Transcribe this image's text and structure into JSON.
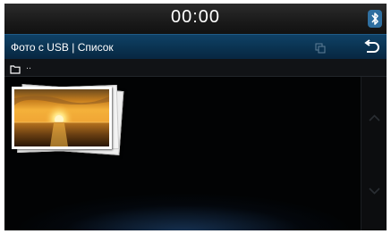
{
  "status_bar": {
    "clock": "00:00",
    "bluetooth_icon": "bluetooth-icon"
  },
  "title_bar": {
    "title": "Фото с USB | Список",
    "copy_icon": "copy-icon",
    "back_icon": "back-arrow-icon"
  },
  "path_bar": {
    "folder_icon": "folder-icon",
    "path": ".."
  },
  "photos": [
    {
      "name": "photo-thumbnail-sunset",
      "icon": "sunset-photo"
    }
  ],
  "scroll": {
    "up_icon": "chevron-up-icon",
    "down_icon": "chevron-down-icon"
  },
  "colors": {
    "title_bar": "#0a3250",
    "accent": "#1f5a86",
    "background": "#000000"
  }
}
